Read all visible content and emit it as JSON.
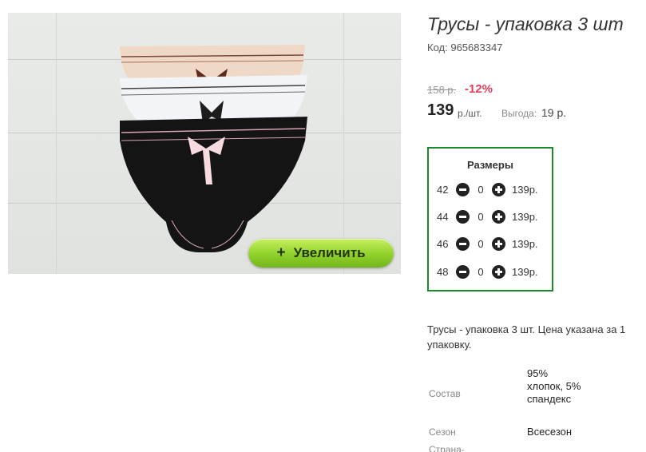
{
  "product": {
    "title": "Трусы - упаковка 3 шт",
    "code_label": "Код:",
    "code_value": "965683347",
    "old_price": "158 р.",
    "discount": "-12%",
    "price": "139",
    "price_unit": "р./шт.",
    "benefit_label": "Выгода:",
    "benefit_value": "19 р.",
    "zoom_label": "Увеличить",
    "description": "Трусы - упаковка 3 шт. Цена указана за 1 упаковку."
  },
  "sizes": {
    "title": "Размеры",
    "rows": [
      {
        "size": "42",
        "qty": "0",
        "price": "139р."
      },
      {
        "size": "44",
        "qty": "0",
        "price": "139р."
      },
      {
        "size": "46",
        "qty": "0",
        "price": "139р."
      },
      {
        "size": "48",
        "qty": "0",
        "price": "139р."
      }
    ]
  },
  "properties": [
    {
      "label": "Состав",
      "value": "95% хлопок, 5% спандекс"
    },
    {
      "label": "Сезон",
      "value": "Всесезон"
    },
    {
      "label": "Страна-",
      "value": ""
    }
  ],
  "colors": {
    "accent_green": "#1a8a2a",
    "discount_red": "#e0405a",
    "zoom_button": "#8fd12a"
  }
}
